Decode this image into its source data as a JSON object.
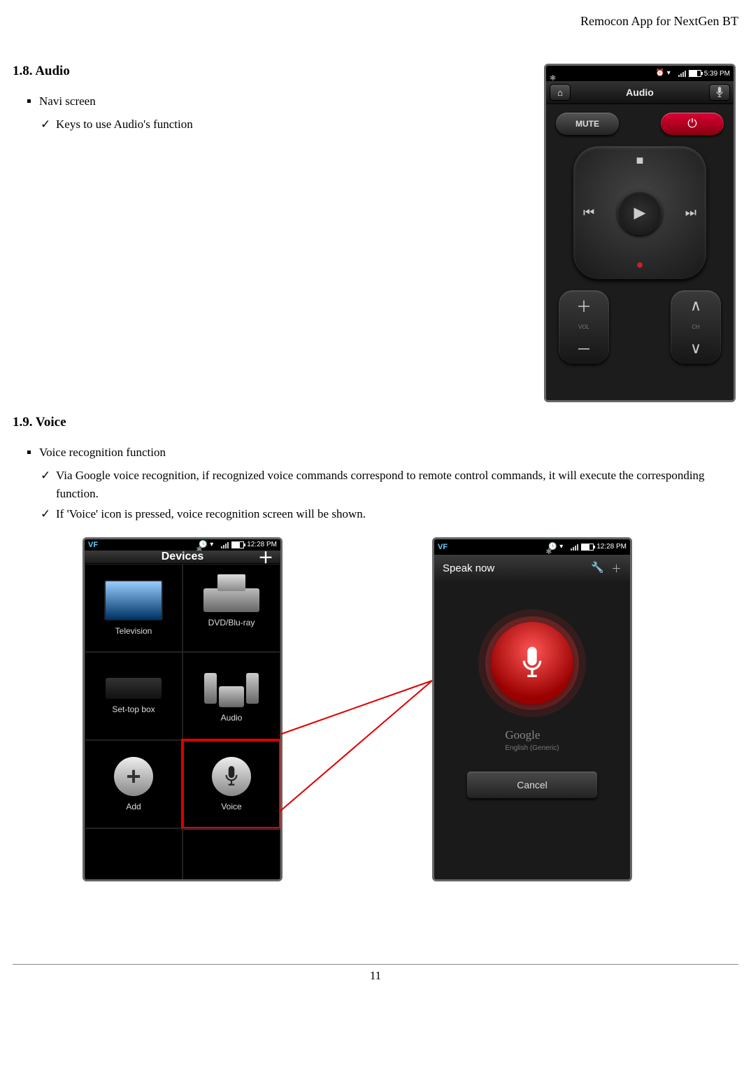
{
  "header": {
    "doc_title": "Remocon App for NextGen BT"
  },
  "section_audio": {
    "heading": "1.8. Audio",
    "bullet": "Navi screen",
    "subbullet": "Keys to use Audio's function"
  },
  "section_voice": {
    "heading": "1.9. Voice",
    "bullet": "Voice recognition function",
    "sub1": "Via Google voice recognition, if recognized voice commands correspond to remote control commands, it will execute the corresponding function.",
    "sub2": "If 'Voice' icon is pressed, voice recognition screen will be shown."
  },
  "audio_phone": {
    "status_time": "5:39 PM",
    "title": "Audio",
    "mute": "MUTE",
    "power_glyph": "⏻",
    "stop_glyph": "■",
    "rec_glyph": "●",
    "prev_glyph": "⏮",
    "play_glyph": "▶",
    "next_glyph": "⏭",
    "vol_label": "VOL",
    "ch_label": "CH",
    "plus": "＋",
    "minus": "－",
    "up": "∧",
    "down": "∨",
    "home_glyph": "⌂",
    "mic_glyph": "●"
  },
  "devices_phone": {
    "status_time": "12:28 PM",
    "title": "Devices",
    "plus": "＋",
    "items": {
      "tv": "Television",
      "dvd": "DVD/Blu-ray",
      "stb": "Set-top box",
      "audio": "Audio",
      "add": "Add",
      "voice": "Voice"
    },
    "add_plus": "+"
  },
  "speak_phone": {
    "status_time": "12:28 PM",
    "title": "Speak now",
    "wrench": "🔧",
    "plus": "＋",
    "google": "Google",
    "lang": "English (Generic)",
    "cancel": "Cancel"
  },
  "footer": {
    "page": "11"
  }
}
